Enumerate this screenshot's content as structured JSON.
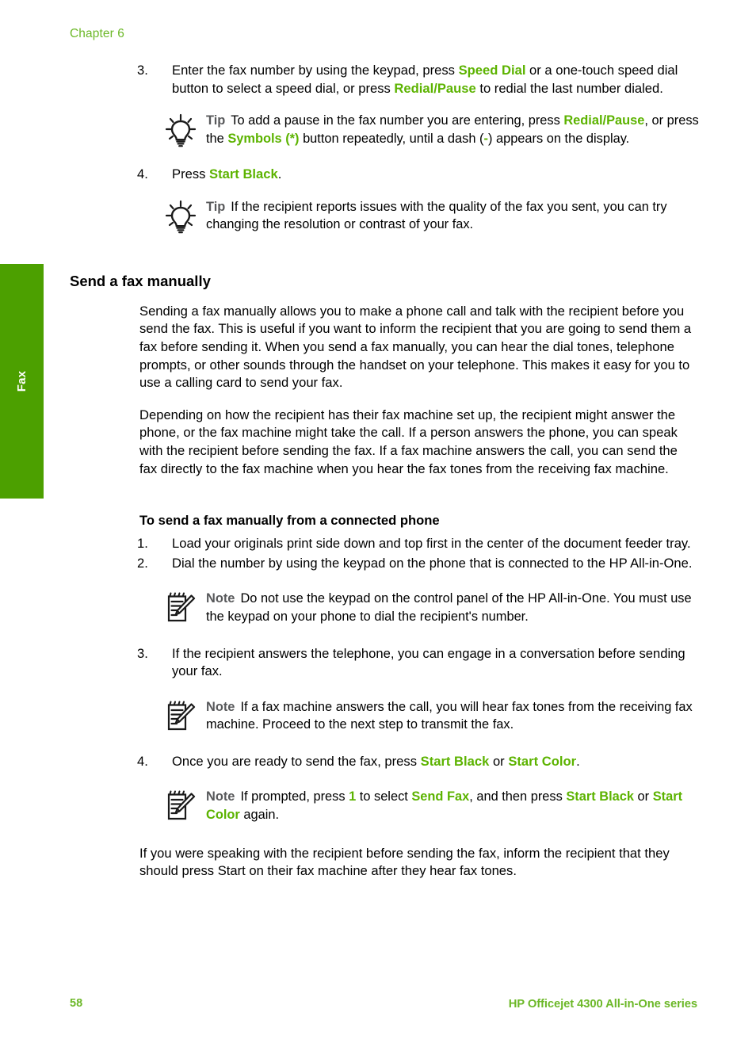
{
  "page": {
    "chapter_label": "Chapter 6",
    "page_number": "58",
    "product_footer": "HP Officejet 4300 All-in-One series",
    "side_tab_label": "Fax",
    "accent_green": "#5cb300",
    "tab_green": "#4ca000",
    "footer_green": "#6cb828",
    "label_gray": "#58595b"
  },
  "top_steps": [
    {
      "number": "3.",
      "parts": [
        {
          "text": "Enter the fax number by using the keypad, press ",
          "style": "normal"
        },
        {
          "text": "Speed Dial",
          "style": "green"
        },
        {
          "text": " or a one-touch speed dial button to select a speed dial, or press ",
          "style": "normal"
        },
        {
          "text": "Redial/Pause",
          "style": "green"
        },
        {
          "text": " to redial the last number dialed.",
          "style": "normal"
        }
      ]
    },
    {
      "number": "4.",
      "parts": [
        {
          "text": "Press ",
          "style": "normal"
        },
        {
          "text": "Start Black",
          "style": "green"
        },
        {
          "text": ".",
          "style": "normal"
        }
      ]
    }
  ],
  "tip_one": {
    "icon": "lightbulb-icon",
    "label": "Tip",
    "parts": [
      {
        "text": "To add a pause in the fax number you are entering, press ",
        "style": "normal"
      },
      {
        "text": "Redial/Pause",
        "style": "green"
      },
      {
        "text": ", or press the ",
        "style": "normal"
      },
      {
        "text": "Symbols (*)",
        "style": "green"
      },
      {
        "text": " button repeatedly, until a dash (",
        "style": "normal"
      },
      {
        "text": "-",
        "style": "green"
      },
      {
        "text": ") appears on the display.",
        "style": "normal"
      }
    ]
  },
  "tip_two": {
    "icon": "lightbulb-icon",
    "label": "Tip",
    "parts": [
      {
        "text": "If the recipient reports issues with the quality of the fax you sent, you can try changing the resolution or contrast of your fax.",
        "style": "normal"
      }
    ]
  },
  "section": {
    "heading": "Send a fax manually",
    "paragraphs": [
      "Sending a fax manually allows you to make a phone call and talk with the recipient before you send the fax. This is useful if you want to inform the recipient that you are going to send them a fax before sending it. When you send a fax manually, you can hear the dial tones, telephone prompts, or other sounds through the handset on your telephone. This makes it easy for you to use a calling card to send your fax.",
      "Depending on how the recipient has their fax machine set up, the recipient might answer the phone, or the fax machine might take the call. If a person answers the phone, you can speak with the recipient before sending the fax. If a fax machine answers the call, you can send the fax directly to the fax machine when you hear the fax tones from the receiving fax machine."
    ]
  },
  "procedure": {
    "heading": "To send a fax manually from a connected phone",
    "steps": [
      {
        "number": "1.",
        "parts": [
          {
            "text": "Load your originals print side down and top first in the center of the document feeder tray.",
            "style": "normal"
          }
        ]
      },
      {
        "number": "2.",
        "parts": [
          {
            "text": "Dial the number by using the keypad on the phone that is connected to the HP All-in-One.",
            "style": "normal"
          }
        ]
      },
      {
        "number": "3.",
        "parts": [
          {
            "text": "If the recipient answers the telephone, you can engage in a conversation before sending your fax.",
            "style": "normal"
          }
        ]
      },
      {
        "number": "4.",
        "parts": [
          {
            "text": "Once you are ready to send the fax, press ",
            "style": "normal"
          },
          {
            "text": "Start Black",
            "style": "green"
          },
          {
            "text": " or ",
            "style": "normal"
          },
          {
            "text": "Start Color",
            "style": "green"
          },
          {
            "text": ".",
            "style": "normal"
          }
        ]
      }
    ]
  },
  "note_one": {
    "icon": "note-pencil-icon",
    "label": "Note",
    "parts": [
      {
        "text": "Do not use the keypad on the control panel of the HP All-in-One. You must use the keypad on your phone to dial the recipient's number.",
        "style": "normal"
      }
    ]
  },
  "note_two": {
    "icon": "note-pencil-icon",
    "label": "Note",
    "parts": [
      {
        "text": "If a fax machine answers the call, you will hear fax tones from the receiving fax machine. Proceed to the next step to transmit the fax.",
        "style": "normal"
      }
    ]
  },
  "note_three": {
    "icon": "note-pencil-icon",
    "label": "Note",
    "parts": [
      {
        "text": "If prompted, press ",
        "style": "normal"
      },
      {
        "text": "1",
        "style": "green"
      },
      {
        "text": " to select ",
        "style": "normal"
      },
      {
        "text": "Send Fax",
        "style": "green"
      },
      {
        "text": ", and then press ",
        "style": "normal"
      },
      {
        "text": "Start Black",
        "style": "green"
      },
      {
        "text": " or ",
        "style": "normal"
      },
      {
        "text": "Start Color",
        "style": "green"
      },
      {
        "text": " again.",
        "style": "normal"
      }
    ]
  },
  "closing_paragraph": "If you were speaking with the recipient before sending the fax, inform the recipient that they should press Start on their fax machine after they hear fax tones."
}
